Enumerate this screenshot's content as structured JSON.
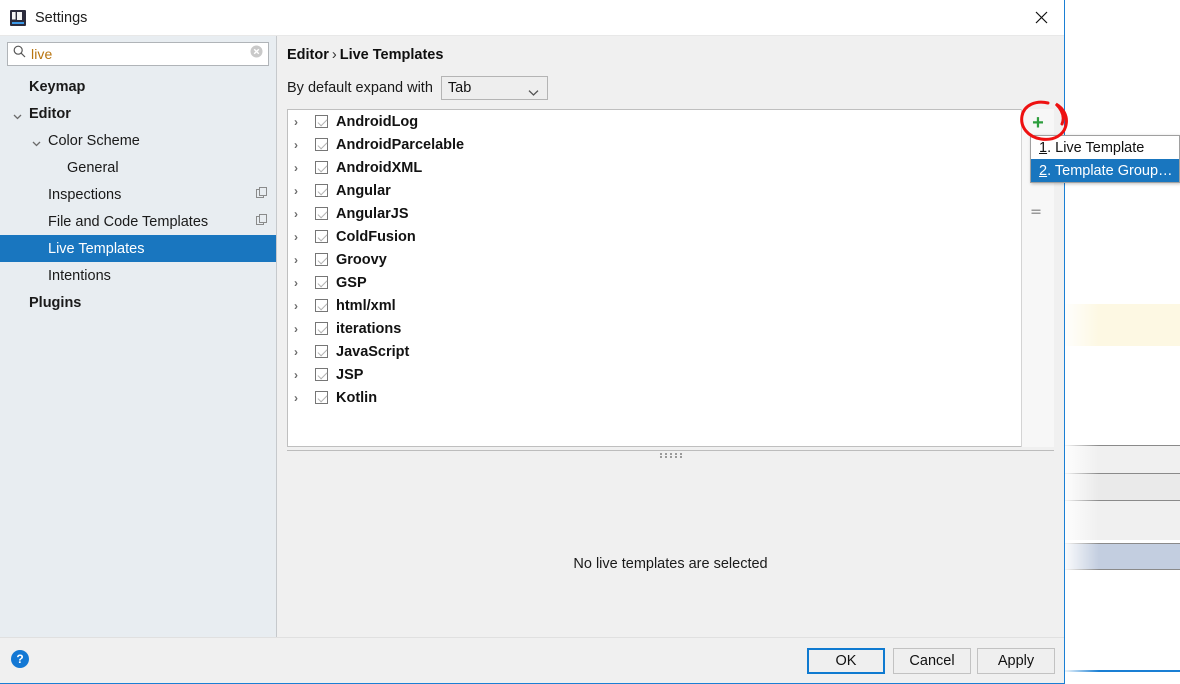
{
  "window": {
    "title": "Settings",
    "app_icon": "intellij-icon",
    "close_icon": "close-icon"
  },
  "sidebar": {
    "search": {
      "value": "live",
      "placeholder": "",
      "search_icon": "search-icon",
      "clear_icon": "clear-icon"
    },
    "items": [
      {
        "label": "Keymap",
        "indent": 0,
        "bold": true,
        "chevron": "none",
        "selected": false,
        "badge": false
      },
      {
        "label": "Editor",
        "indent": 0,
        "bold": true,
        "chevron": "down",
        "selected": false,
        "badge": false
      },
      {
        "label": "Color Scheme",
        "indent": 1,
        "bold": false,
        "chevron": "down",
        "selected": false,
        "badge": false
      },
      {
        "label": "General",
        "indent": 2,
        "bold": false,
        "chevron": "none",
        "selected": false,
        "badge": false
      },
      {
        "label": "Inspections",
        "indent": 1,
        "bold": false,
        "chevron": "none",
        "selected": false,
        "badge": true
      },
      {
        "label": "File and Code Templates",
        "indent": 1,
        "bold": false,
        "chevron": "none",
        "selected": false,
        "badge": true
      },
      {
        "label": "Live Templates",
        "indent": 1,
        "bold": false,
        "chevron": "none",
        "selected": true,
        "badge": false
      },
      {
        "label": "Intentions",
        "indent": 1,
        "bold": false,
        "chevron": "none",
        "selected": false,
        "badge": false
      },
      {
        "label": "Plugins",
        "indent": 0,
        "bold": true,
        "chevron": "none",
        "selected": false,
        "badge": false
      }
    ]
  },
  "main": {
    "breadcrumb": {
      "parent": "Editor",
      "separator": "›",
      "current": "Live Templates"
    },
    "expand_with": {
      "label": "By default expand with",
      "value": "Tab",
      "caret_icon": "chevron-down-icon"
    },
    "templates": [
      {
        "name": "AndroidLog",
        "checked": true
      },
      {
        "name": "AndroidParcelable",
        "checked": true
      },
      {
        "name": "AndroidXML",
        "checked": true
      },
      {
        "name": "Angular",
        "checked": true
      },
      {
        "name": "AngularJS",
        "checked": true
      },
      {
        "name": "ColdFusion",
        "checked": true
      },
      {
        "name": "Groovy",
        "checked": true
      },
      {
        "name": "GSP",
        "checked": true
      },
      {
        "name": "html/xml",
        "checked": true
      },
      {
        "name": "iterations",
        "checked": true
      },
      {
        "name": "JavaScript",
        "checked": true
      },
      {
        "name": "JSP",
        "checked": true
      },
      {
        "name": "Kotlin",
        "checked": true
      }
    ],
    "toolbar": {
      "add_icon": "plus-icon",
      "add_label": "+"
    },
    "empty_message": "No live templates are selected"
  },
  "popup_menu": {
    "items": [
      {
        "mnemonic": "1",
        "label": ". Live Template",
        "selected": false
      },
      {
        "mnemonic": "2",
        "label": ". Template Group…",
        "selected": true
      }
    ]
  },
  "footer": {
    "help_icon": "help-icon",
    "help_label": "?",
    "ok": "OK",
    "cancel": "Cancel",
    "apply": "Apply"
  },
  "colors": {
    "accent_blue": "#1976bf",
    "window_border": "#1a7fd4",
    "sidebar_bg": "#e8edf1",
    "panel_bg": "#f0f0f0",
    "annotation_red": "#ee1111",
    "plus_green": "#2e9e3e",
    "search_text": "#b8740f"
  }
}
